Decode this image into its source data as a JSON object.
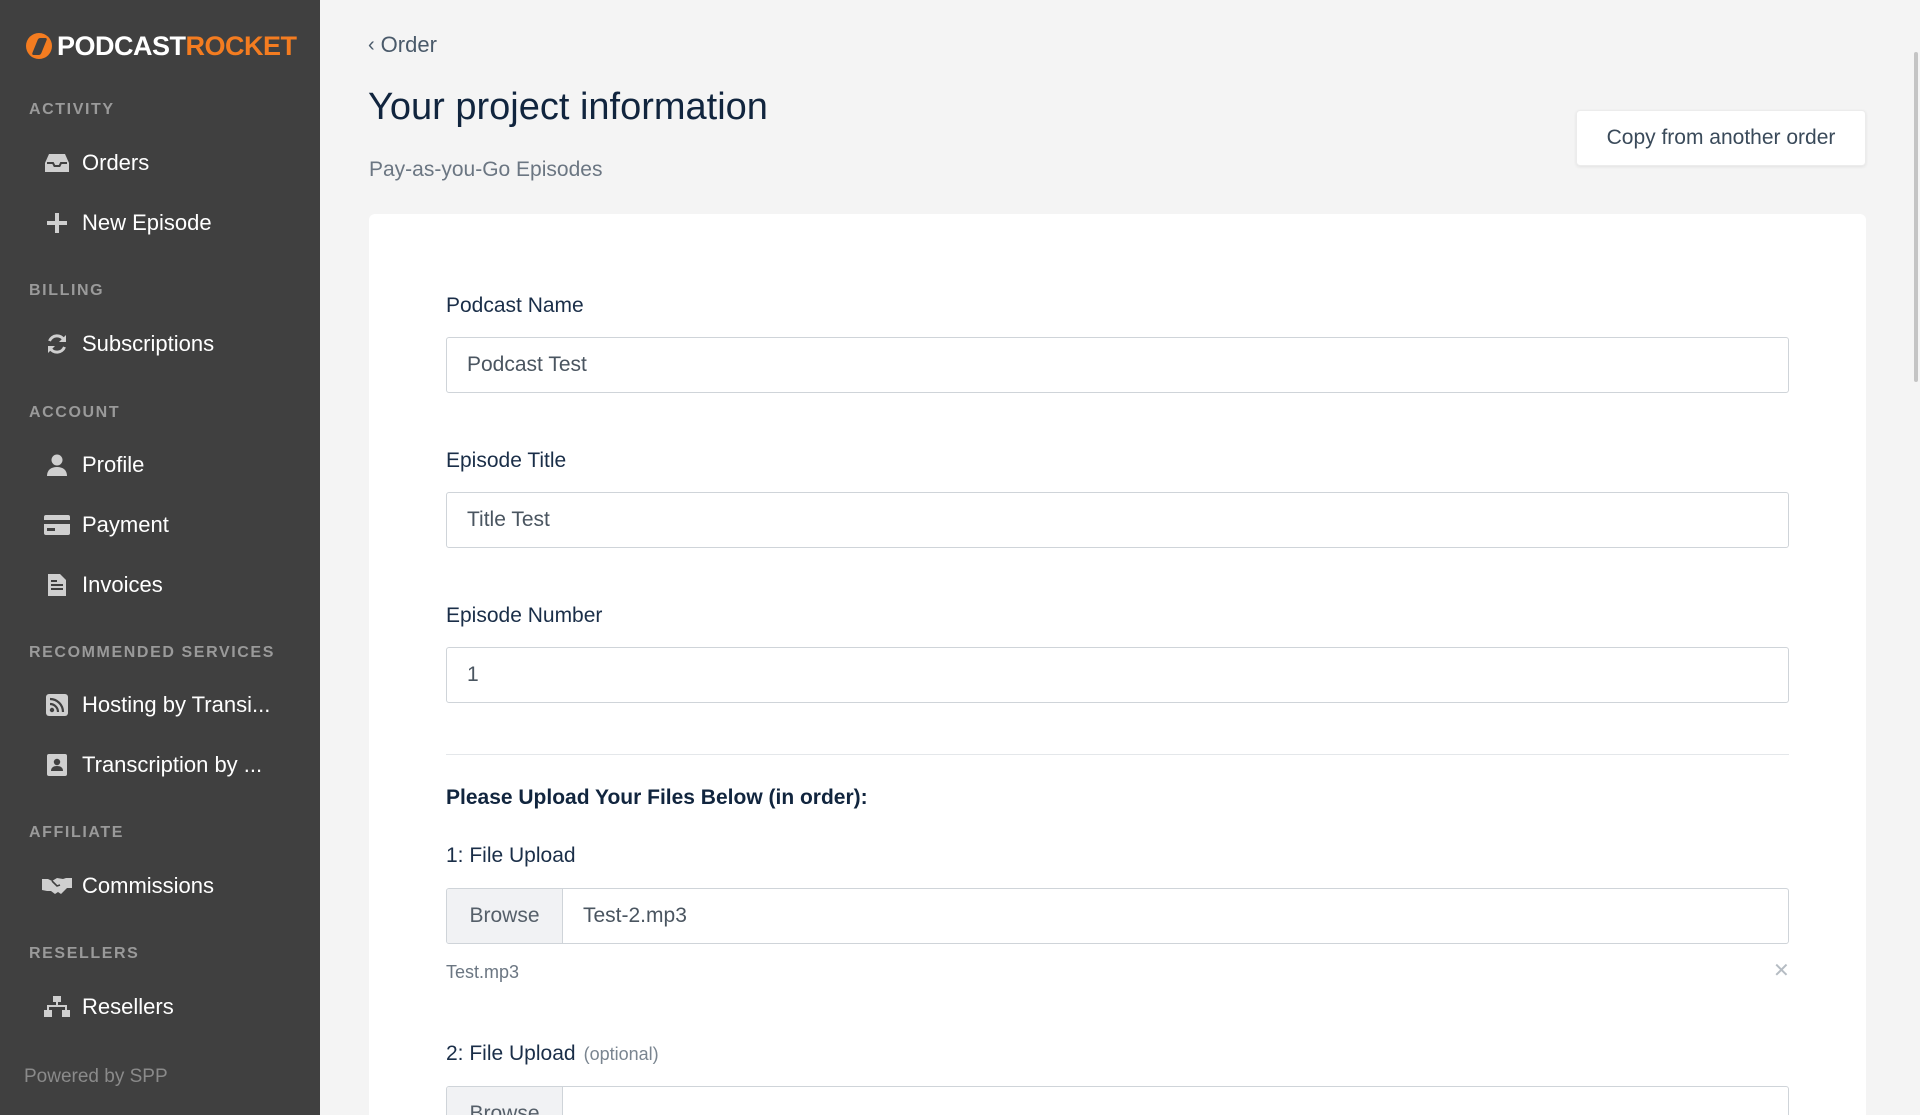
{
  "logo": {
    "part1": "PODCAST",
    "part2": "ROCKET"
  },
  "sidebar": {
    "sections": {
      "activity": "ACTIVITY",
      "billing": "BILLING",
      "account": "ACCOUNT",
      "recommended": "RECOMMENDED SERVICES",
      "affiliate": "AFFILIATE",
      "resellers": "RESELLERS"
    },
    "items": {
      "orders": {
        "label": "Orders",
        "icon": "inbox-icon"
      },
      "new_episode": {
        "label": "New Episode",
        "icon": "plus-icon"
      },
      "subscriptions": {
        "label": "Subscriptions",
        "icon": "refresh-icon"
      },
      "profile": {
        "label": "Profile",
        "icon": "user-icon"
      },
      "payment": {
        "label": "Payment",
        "icon": "credit-card-icon"
      },
      "invoices": {
        "label": "Invoices",
        "icon": "document-icon"
      },
      "hosting": {
        "label": "Hosting by Transi...",
        "icon": "rss-icon"
      },
      "transcription": {
        "label": "Transcription by ...",
        "icon": "contact-book-icon"
      },
      "commissions": {
        "label": "Commissions",
        "icon": "handshake-icon"
      },
      "resellers": {
        "label": "Resellers",
        "icon": "sitemap-icon"
      }
    },
    "powered_by": "Powered by SPP"
  },
  "header": {
    "back_label": "Order",
    "title": "Your project information",
    "subtitle": "Pay-as-you-Go Episodes",
    "copy_button": "Copy from another order"
  },
  "form": {
    "podcast_name": {
      "label": "Podcast Name",
      "value": "Podcast Test"
    },
    "episode_title": {
      "label": "Episode Title",
      "value": "Title Test"
    },
    "episode_number": {
      "label": "Episode Number",
      "value": "1"
    },
    "upload_heading": "Please Upload Your Files Below (in order):",
    "upload1": {
      "label": "1: File Upload",
      "browse": "Browse",
      "filename": "Test-2.mp3",
      "uploaded": "Test.mp3"
    },
    "upload2": {
      "label": "2: File Upload",
      "optional": "(optional)",
      "browse": "Browse",
      "filename": ""
    }
  },
  "colors": {
    "accent": "#f47c20",
    "sidebar_bg": "#404040",
    "title": "#11253e"
  }
}
